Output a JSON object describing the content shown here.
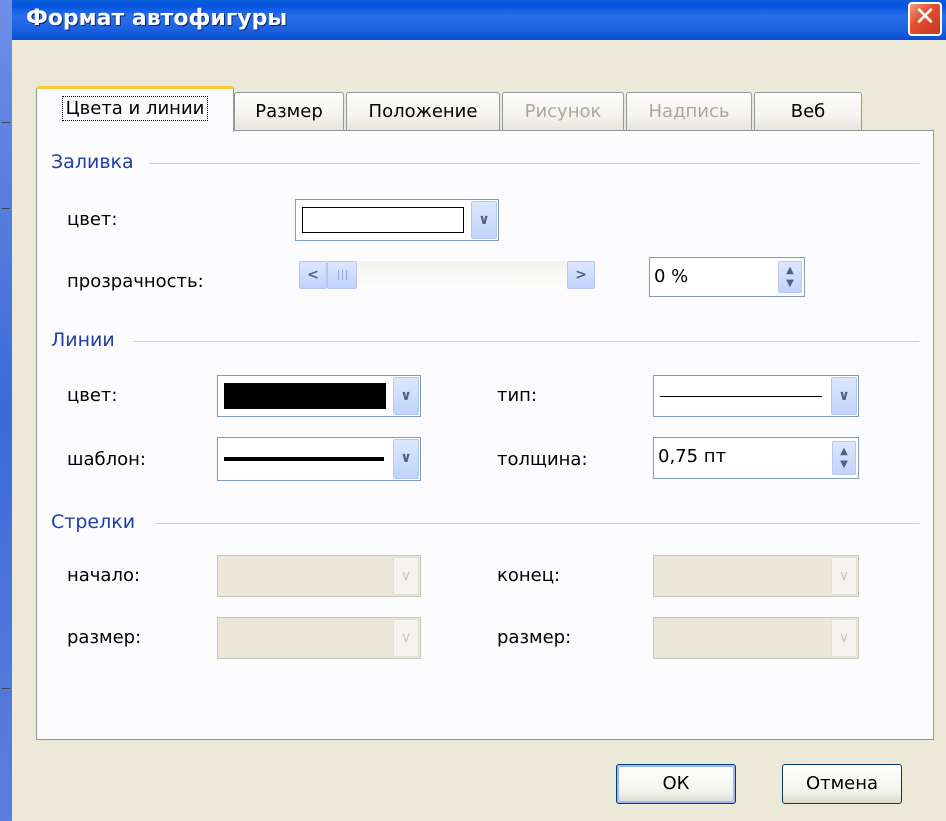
{
  "window": {
    "title": "Формат автофигуры",
    "close_glyph": "✕"
  },
  "tabs": [
    {
      "label": "Цвета и линии",
      "state": "active"
    },
    {
      "label": "Размер",
      "state": "normal"
    },
    {
      "label": "Положение",
      "state": "normal"
    },
    {
      "label": "Рисунок",
      "state": "disabled"
    },
    {
      "label": "Надпись",
      "state": "disabled"
    },
    {
      "label": "Веб",
      "state": "normal"
    }
  ],
  "fill": {
    "group_label": "Заливка",
    "color_label": "цвет:",
    "color_value": "#ffffff",
    "transparency_label": "прозрачность:",
    "transparency_value": "0 %",
    "transparency_fraction": 0
  },
  "lines": {
    "group_label": "Линии",
    "color_label": "цвет:",
    "color_value": "#000000",
    "type_label": "тип:",
    "pattern_label": "шаблон:",
    "weight_label": "толщина:",
    "weight_value": "0,75 пт"
  },
  "arrows": {
    "group_label": "Стрелки",
    "begin_label": "начало:",
    "end_label": "конец:",
    "begin_size_label": "размер:",
    "end_size_label": "размер:"
  },
  "buttons": {
    "ok": "ОК",
    "cancel": "Отмена"
  },
  "icons": {
    "dropdown": "chevron-down-icon",
    "scroll_left": "chevron-left-icon",
    "scroll_right": "chevron-right-icon",
    "spin": "spin-updown-icon"
  },
  "colors": {
    "titlebar": "#0554e0",
    "group_label": "#1f3fa8",
    "active_tab_accent": "#ffc83c",
    "close_button": "#e05030"
  }
}
